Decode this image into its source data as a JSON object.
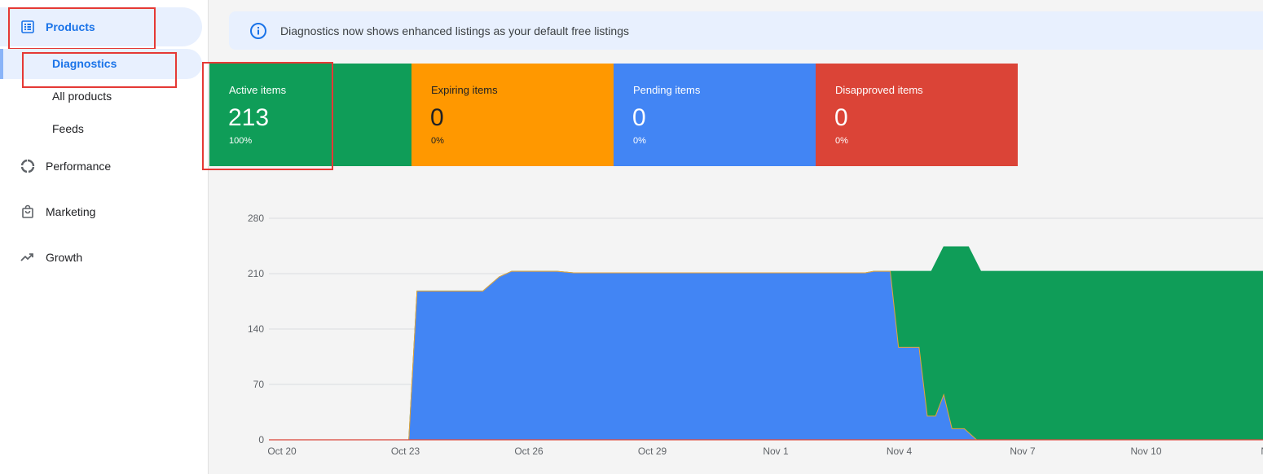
{
  "sidebar": {
    "products": "Products",
    "diagnostics": "Diagnostics",
    "all_products": "All products",
    "feeds": "Feeds",
    "performance": "Performance",
    "marketing": "Marketing",
    "growth": "Growth"
  },
  "banner": {
    "text": "Diagnostics now shows enhanced listings as your default free listings"
  },
  "cards": [
    {
      "title": "Active items",
      "value": "213",
      "percent": "100%",
      "color": "#0f9d58",
      "text_color": "#ffffff"
    },
    {
      "title": "Expiring items",
      "value": "0",
      "percent": "0%",
      "color": "#ff9800",
      "text_color": "#202124"
    },
    {
      "title": "Pending items",
      "value": "0",
      "percent": "0%",
      "color": "#4285f4",
      "text_color": "#ffffff"
    },
    {
      "title": "Disapproved items",
      "value": "0",
      "percent": "0%",
      "color": "#db4437",
      "text_color": "#ffffff"
    }
  ],
  "colors": {
    "active": "#0f9d58",
    "pending": "#4285f4",
    "expiring": "#ff9800",
    "disapproved": "#db4437",
    "accent": "#1a73e8"
  },
  "chart_data": {
    "type": "area",
    "ylim": [
      0,
      280
    ],
    "yticks": [
      0,
      70,
      140,
      210,
      280
    ],
    "xlim": [
      "Oct 20",
      "Nov 12"
    ],
    "xtick_labels": [
      "Oct 20",
      "Oct 23",
      "Oct 26",
      "Oct 29",
      "Nov 1",
      "Nov 4",
      "Nov 7",
      "Nov 10",
      "Nov"
    ],
    "xtick_positions": [
      0,
      3,
      6,
      9,
      12,
      15,
      18,
      21,
      24
    ],
    "series": [
      {
        "name": "",
        "color": "#4285f4",
        "points": [
          [
            0,
            0
          ],
          [
            3.4,
            0
          ],
          [
            3.6,
            188
          ],
          [
            4.0,
            188
          ],
          [
            4.6,
            188
          ],
          [
            5.2,
            188
          ],
          [
            5.6,
            206
          ],
          [
            5.9,
            213
          ],
          [
            7.0,
            213
          ],
          [
            7.4,
            211
          ],
          [
            12,
            211
          ],
          [
            14.5,
            211
          ],
          [
            14.7,
            213
          ],
          [
            15.1,
            213
          ],
          [
            15.3,
            117
          ],
          [
            15.8,
            117
          ],
          [
            16.0,
            30
          ],
          [
            16.2,
            30
          ],
          [
            16.4,
            57
          ],
          [
            16.6,
            14
          ],
          [
            16.9,
            14
          ],
          [
            17.2,
            0
          ],
          [
            24.5,
            0
          ]
        ]
      },
      {
        "name": "",
        "color": "#0f9d58",
        "points": [
          [
            0,
            0
          ],
          [
            3.4,
            0
          ],
          [
            3.6,
            188
          ],
          [
            4.0,
            188
          ],
          [
            4.6,
            188
          ],
          [
            5.2,
            188
          ],
          [
            5.6,
            206
          ],
          [
            5.9,
            213
          ],
          [
            7.0,
            213
          ],
          [
            7.4,
            211
          ],
          [
            12,
            211
          ],
          [
            14.5,
            211
          ],
          [
            14.7,
            213
          ],
          [
            15.1,
            213
          ],
          [
            16.1,
            213
          ],
          [
            16.4,
            244
          ],
          [
            17.0,
            244
          ],
          [
            17.3,
            213
          ],
          [
            24.5,
            213
          ]
        ]
      }
    ]
  }
}
